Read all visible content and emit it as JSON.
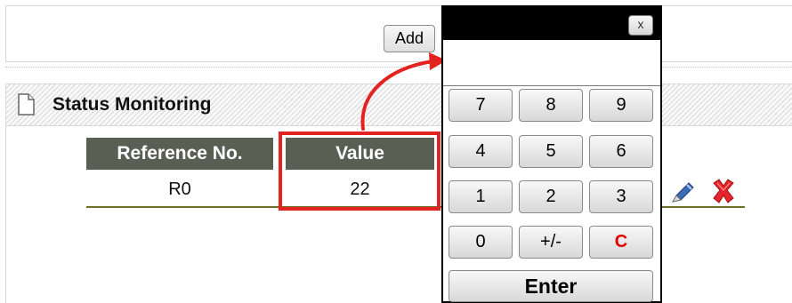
{
  "toolbar": {
    "add_label": "Add"
  },
  "status": {
    "title": "Status Monitoring"
  },
  "table": {
    "headers": [
      "Reference No.",
      "Value"
    ],
    "rows": [
      {
        "reference": "R0",
        "value": "22"
      }
    ]
  },
  "calculator": {
    "close_label": "x",
    "display_value": "",
    "keys": [
      "7",
      "8",
      "9",
      "4",
      "5",
      "6",
      "1",
      "2",
      "3",
      "0",
      "+/-",
      "C"
    ],
    "enter_label": "Enter"
  },
  "icons": {
    "document": "document-icon",
    "edit": "pencil-icon",
    "delete": "delete-icon",
    "close": "close-icon"
  },
  "colors": {
    "table_header": "#5a5f53",
    "highlight": "#e32320",
    "calculator_titlebar": "#000000",
    "clear_key": "#e00000"
  }
}
